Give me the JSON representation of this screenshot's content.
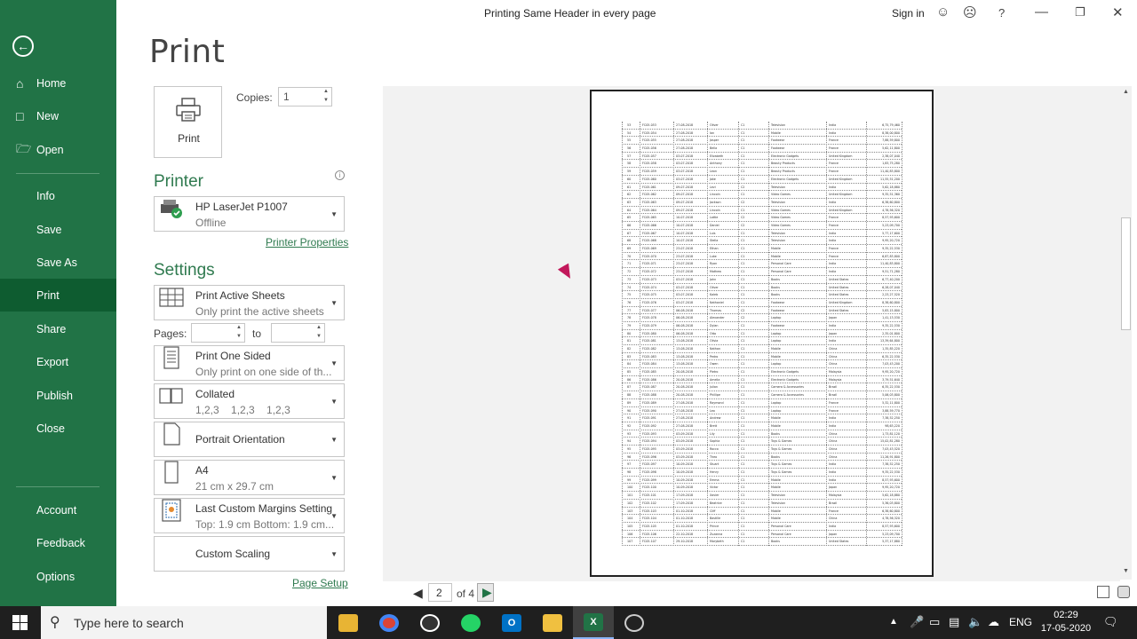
{
  "window": {
    "title": "Printing Same Header in every page",
    "sign_in": "Sign in",
    "help": "?"
  },
  "nav": {
    "items": [
      {
        "label": "Home",
        "icon": "home-icon"
      },
      {
        "label": "New",
        "icon": "new-document-icon"
      },
      {
        "label": "Open",
        "icon": "folder-open-icon"
      },
      {
        "label": "Info"
      },
      {
        "label": "Save"
      },
      {
        "label": "Save As"
      },
      {
        "label": "Print",
        "active": true
      },
      {
        "label": "Share"
      },
      {
        "label": "Export"
      },
      {
        "label": "Publish"
      },
      {
        "label": "Close"
      },
      {
        "label": "Account"
      },
      {
        "label": "Feedback"
      },
      {
        "label": "Options"
      }
    ]
  },
  "print": {
    "heading": "Print",
    "button_label": "Print",
    "copies_label": "Copies:",
    "copies_value": "1",
    "printer_heading": "Printer",
    "printer_name": "HP LaserJet P1007",
    "printer_status": "Offline",
    "printer_properties": "Printer Properties",
    "settings_heading": "Settings",
    "what": {
      "title": "Print Active Sheets",
      "sub": "Only print the active sheets"
    },
    "pages_label": "Pages:",
    "to_label": "to",
    "sided": {
      "title": "Print One Sided",
      "sub": "Only print on one side of th..."
    },
    "collation": {
      "title": "Collated",
      "sub": "1,2,3    1,2,3    1,2,3"
    },
    "orientation": {
      "title": "Portrait Orientation"
    },
    "paper": {
      "title": "A4",
      "sub": "21 cm x 29.7 cm"
    },
    "margins": {
      "title": "Last Custom Margins Setting",
      "sub": "Top: 1.9 cm Bottom: 1.9 cm..."
    },
    "scaling": {
      "title": "Custom Scaling"
    },
    "page_setup": "Page Setup"
  },
  "preview": {
    "current_page": "2",
    "of_total": "of 4"
  },
  "sheet_rows": [
    [
      "53",
      "FC05-053",
      "27-08-2018",
      "Oliver",
      "C1",
      "Television",
      "India",
      "6,75,79,460"
    ],
    [
      "54",
      "FC05-054",
      "27-08-2018",
      "Ian",
      "C1",
      "Mobile",
      "India",
      "8,38,00,800"
    ],
    [
      "55",
      "FC05-055",
      "27-08-2018",
      "Jasper",
      "C1",
      "Footwear",
      "France",
      "7,88,59,800"
    ],
    [
      "56",
      "FC05-056",
      "27-08-2018",
      "Bella",
      "C1",
      "Footwear",
      "France",
      "5,62,11,800"
    ],
    [
      "57",
      "FC05-057",
      "03-07-2018",
      "Elizabeth",
      "C1",
      "Electronic Gadgets",
      "United Kingdom",
      "2,38,07,040"
    ],
    [
      "58",
      "FC05-058",
      "03-07-2018",
      "Anthony",
      "C1",
      "Beauty Products",
      "France",
      "1,83,75,280"
    ],
    [
      "59",
      "FC05-059",
      "03-07-2018",
      "Leon",
      "C1",
      "Beauty Products",
      "France",
      "11,40,83,800"
    ],
    [
      "60",
      "FC05-060",
      "03-07-2018",
      "Jake",
      "C1",
      "Electronic Gadgets",
      "United Kingdom",
      "11,55,51,200"
    ],
    [
      "61",
      "FC05-061",
      "09-07-2018",
      "Levi",
      "C2",
      "Television",
      "India",
      "5,62,18,880"
    ],
    [
      "62",
      "FC05-062",
      "09-07-2018",
      "Lincoln",
      "C1",
      "Video Games",
      "United Kingdom",
      "9,35,51,360"
    ],
    [
      "63",
      "FC05-063",
      "09-07-2018",
      "Jackson",
      "C2",
      "Television",
      "India",
      "6,38,60,800"
    ],
    [
      "64",
      "FC05-064",
      "09-07-2018",
      "Lincoln",
      "C1",
      "Video Games",
      "United Kingdom",
      "4,78,56,320"
    ],
    [
      "65",
      "FC05-065",
      "10-07-2018",
      "Lottie",
      "C2",
      "Video Games",
      "France",
      "8,57,93,600"
    ],
    [
      "66",
      "FC05-066",
      "10-07-2018",
      "Daniel",
      "C2",
      "Video Games",
      "France",
      "5,23,09,700"
    ],
    [
      "67",
      "FC05-067",
      "10-07-2018",
      "Luis",
      "C1",
      "Television",
      "India",
      "5,77,17,600"
    ],
    [
      "68",
      "FC05-068",
      "10-07-2018",
      "Stella",
      "C1",
      "Television",
      "India",
      "9,95,20,720"
    ],
    [
      "69",
      "FC05-069",
      "23-07-2018",
      "Ethan",
      "C1",
      "Mobile",
      "France",
      "9,35,22,530"
    ],
    [
      "70",
      "FC05-070",
      "23-07-2018",
      "Luke",
      "C1",
      "Mobile",
      "France",
      "6,87,83,800"
    ],
    [
      "71",
      "FC05-071",
      "23-07-2018",
      "Ryan",
      "C1",
      "Personal Care",
      "India",
      "11,40,83,800"
    ],
    [
      "72",
      "FC05-072",
      "23-07-2018",
      "Mathew",
      "C1",
      "Personal Care",
      "India",
      "9,51,71,280"
    ],
    [
      "73",
      "FC05-073",
      "03-07-2018",
      "John",
      "C1",
      "Books",
      "United States",
      "6,77,40,200"
    ],
    [
      "74",
      "FC05-074",
      "03-07-2018",
      "Oliver",
      "C1",
      "Books",
      "United States",
      "6,28,07,040"
    ],
    [
      "75",
      "FC05-075",
      "03-07-2018",
      "Kaleb",
      "C1",
      "Books",
      "United States",
      "2,23,27,520"
    ],
    [
      "76",
      "FC05-076",
      "03-07-2018",
      "Nathaniel",
      "C1",
      "Footwear",
      "United Kingdom",
      "8,38,60,800"
    ],
    [
      "77",
      "FC05-077",
      "06-08-2018",
      "Thomas",
      "C2",
      "Footwear",
      "United States",
      "5,83,15,800"
    ],
    [
      "78",
      "FC05-078",
      "06-08-2018",
      "Alexander",
      "C2",
      "Laptop",
      "Japan",
      "1,41,13,530"
    ],
    [
      "79",
      "FC05-079",
      "06-08-2018",
      "Dylan",
      "C1",
      "Footwear",
      "India",
      "9,35,22,530"
    ],
    [
      "80",
      "FC05-080",
      "06-08-2018",
      "Otto",
      "C1",
      "Laptop",
      "Japan",
      "2,35,01,800"
    ],
    [
      "81",
      "FC05-081",
      "13-08-2018",
      "Olivia",
      "C1",
      "Laptop",
      "India",
      "13,39,64,800"
    ],
    [
      "82",
      "FC05-082",
      "13-08-2018",
      "Nathan",
      "C1",
      "Mobile",
      "China",
      "1,35,85,220"
    ],
    [
      "83",
      "FC05-083",
      "13-08-2018",
      "Pedro",
      "C1",
      "Mobile",
      "China",
      "6,35,22,530"
    ],
    [
      "84",
      "FC05-084",
      "13-08-2018",
      "Owen",
      "C1",
      "Laptop",
      "China",
      "7,03,43,200"
    ],
    [
      "85",
      "FC05-085",
      "20-08-2018",
      "Pietro",
      "C1",
      "Electronic Gadgets",
      "Malaysia",
      "9,95,20,720"
    ],
    [
      "86",
      "FC05-086",
      "20-08-2018",
      "Amelia",
      "C1",
      "Electronic Gadgets",
      "Malaysia",
      "3,79,51,640"
    ],
    [
      "87",
      "FC05-087",
      "20-08-2018",
      "Julian",
      "C1",
      "Camera & Accessories",
      "Brazil",
      "6,35,22,530"
    ],
    [
      "88",
      "FC05-088",
      "20-08-2018",
      "Phillipe",
      "C1",
      "Camera & Accessories",
      "Brazil",
      "5,06,03,800"
    ],
    [
      "89",
      "FC05-089",
      "27-08-2018",
      "Raymond",
      "C1",
      "Laptop",
      "France",
      "5,32,11,800"
    ],
    [
      "90",
      "FC05-090",
      "27-08-2018",
      "Leo",
      "C1",
      "Laptop",
      "France",
      "3,88,59,770"
    ],
    [
      "91",
      "FC05-091",
      "27-08-2018",
      "Andrew",
      "C1",
      "Mobile",
      "India",
      "7,38,52,250"
    ],
    [
      "92",
      "FC05-092",
      "27-08-2018",
      "Brett",
      "C1",
      "Mobile",
      "India",
      "98,63,220"
    ],
    [
      "93",
      "FC05-093",
      "03-09-2018",
      "Lily",
      "C1",
      "Books",
      "China",
      "1,73,81,120"
    ],
    [
      "94",
      "FC05-094",
      "03-09-2018",
      "Sophia",
      "C1",
      "Toys & Games",
      "China",
      "15,02,81,280"
    ],
    [
      "95",
      "FC05-095",
      "03-09-2018",
      "Rocco",
      "C1",
      "Toys & Games",
      "China",
      "7,03,43,520"
    ],
    [
      "96",
      "FC05-096",
      "03-09-2018",
      "Theo",
      "C1",
      "Books",
      "China",
      "11,26,91,800"
    ],
    [
      "97",
      "FC05-097",
      "10-09-2018",
      "Stuart",
      "C1",
      "Toys & Games",
      "India",
      "7,38,52,250"
    ],
    [
      "98",
      "FC05-098",
      "10-09-2018",
      "Henry",
      "C1",
      "Toys & Games",
      "India",
      "9,35,22,530"
    ],
    [
      "99",
      "FC05-099",
      "10-09-2018",
      "Emma",
      "C1",
      "Mobile",
      "India",
      "8,57,93,600"
    ],
    [
      "100",
      "FC05-100",
      "10-09-2018",
      "Victor",
      "C1",
      "Mobile",
      "Japan",
      "9,95,20,720"
    ],
    [
      "101",
      "FC05-101",
      "17-09-2018",
      "Xavier",
      "C1",
      "Television",
      "Malaysia",
      "5,62,18,880"
    ],
    [
      "102",
      "FC05-102",
      "17-09-2018",
      "Beatrice",
      "C1",
      "Television",
      "Brazil",
      "5,36,03,800"
    ],
    [
      "103",
      "FC05-103",
      "01-10-2018",
      "Cliff",
      "C1",
      "Mobile",
      "France",
      "6,38,60,800"
    ],
    [
      "104",
      "FC05-104",
      "01-10-2018",
      "Bastille",
      "C1",
      "Mobile",
      "China",
      "4,78,56,320"
    ],
    [
      "105",
      "FC05-105",
      "01-10-2018",
      "Prince",
      "C1",
      "Personal Care",
      "India",
      "8,57,93,600"
    ],
    [
      "106",
      "FC05-106",
      "22-10-2018",
      "Zuzanna",
      "C1",
      "Personal Care",
      "Japan",
      "5,23,09,700"
    ],
    [
      "107",
      "FC05-107",
      "29-10-2018",
      "Marybeth",
      "C1",
      "Books",
      "United States",
      "5,37,17,880"
    ]
  ],
  "taskbar": {
    "search_placeholder": "Type here to search",
    "lang": "ENG",
    "time": "02:29",
    "date": "17-05-2020"
  }
}
